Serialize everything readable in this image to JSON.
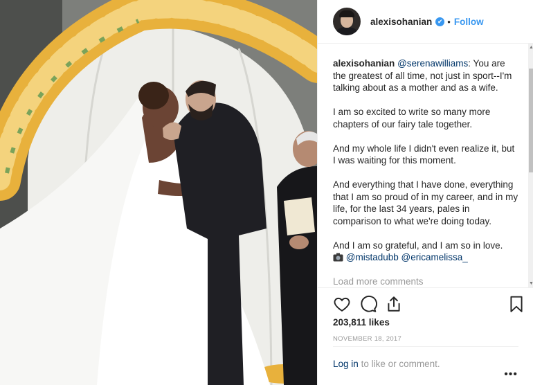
{
  "post": {
    "username": "alexisohanian",
    "verified_mark": "✔",
    "separator": "•",
    "follow_label": "Follow"
  },
  "caption": {
    "author": "alexisohanian",
    "mention": "@serenawilliams",
    "line1_rest": ": You are the greatest of all time, not just in sport--I'm talking about as a mother and as a wife.",
    "p2": "I am so excited to write so many more chapters of our fairy tale together.",
    "p3": "And my whole life I didn't even realize it, but I was waiting for this moment.",
    "p4": "And everything that I have done, everything that I am so proud of in my career, and in my life, for the last 34 years, pales in comparison to what we're doing today.",
    "p5": "And I am so grateful, and I am so in love.",
    "camera_icon": "camera-icon",
    "credit1": "@mistadubb",
    "credit2": "@ericamelissa_"
  },
  "load_more_label": "Load more comments",
  "likes_label": "203,811 likes",
  "date_label": "NOVEMBER 18, 2017",
  "login": {
    "link_label": "Log in",
    "rest": "to like or comment."
  },
  "more_label": "•••",
  "icons": [
    "heart-icon",
    "comment-icon",
    "share-icon",
    "bookmark-icon"
  ],
  "colors": {
    "accent": "#3897f0",
    "link": "#003569",
    "muted": "#999999",
    "text": "#262626"
  }
}
